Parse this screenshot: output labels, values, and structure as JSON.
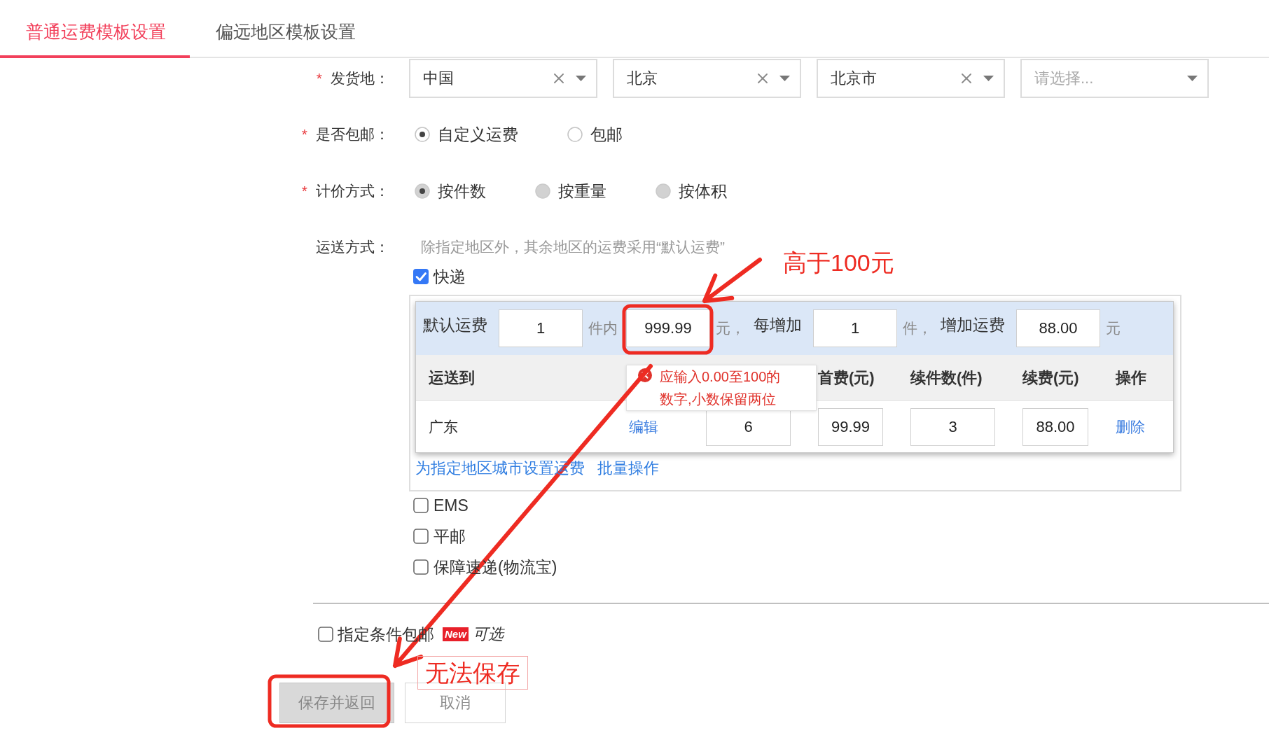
{
  "tabs": [
    {
      "label": "普通运费模板设置",
      "selected": true
    },
    {
      "label": "偏远地区模板设置",
      "selected": false
    }
  ],
  "ship_from": {
    "required_mark": "*",
    "label": "发货地：",
    "selects": [
      {
        "value": "中国"
      },
      {
        "value": "北京"
      },
      {
        "value": "北京市"
      },
      {
        "placeholder": "请选择..."
      }
    ]
  },
  "free_shipping": {
    "required_mark": "*",
    "label": "是否包邮：",
    "disabled": false,
    "options": [
      {
        "label": "自定义运费",
        "selected": true
      },
      {
        "label": "包邮",
        "selected": false
      }
    ]
  },
  "pricing_method": {
    "required_mark": "*",
    "label": "计价方式：",
    "disabled": true,
    "options": [
      {
        "label": "按件数",
        "selected": true
      },
      {
        "label": "按重量",
        "selected": false
      },
      {
        "label": "按体积",
        "selected": false
      }
    ]
  },
  "delivery": {
    "label": "运送方式：",
    "hint": "除指定地区外，其余地区的运费采用“默认运费”",
    "methods": [
      {
        "label": "快递",
        "checked": true,
        "panel": {
          "default_fee": [
            {
              "kind": "label",
              "text": "默认运费"
            },
            {
              "kind": "input",
              "value": "1"
            },
            {
              "kind": "unit",
              "text": "件内"
            },
            {
              "kind": "input",
              "value": "999.99"
            },
            {
              "kind": "unit",
              "text": "元，"
            },
            {
              "kind": "label",
              "text": "每增加"
            },
            {
              "kind": "input",
              "value": "1"
            },
            {
              "kind": "unit",
              "text": "件，"
            },
            {
              "kind": "label",
              "text": "增加运费"
            },
            {
              "kind": "input",
              "value": "88.00"
            },
            {
              "kind": "unit",
              "text": "元"
            }
          ],
          "columns": [
            {
              "kind": "heading",
              "label": "运送到"
            },
            {
              "kind": "covered"
            },
            {
              "kind": "covered"
            },
            {
              "kind": "heading",
              "label": "首费(元)"
            },
            {
              "kind": "heading",
              "label": "续件数(件)"
            },
            {
              "kind": "heading",
              "label": "续费(元)"
            },
            {
              "kind": "heading",
              "label": "操作"
            }
          ],
          "rows": [
            {
              "cells": [
                {
                  "kind": "text",
                  "text": "广东"
                },
                {
                  "kind": "link",
                  "text": "编辑"
                },
                {
                  "kind": "input",
                  "value": "6"
                },
                {
                  "kind": "input",
                  "value": "99.99"
                },
                {
                  "kind": "input",
                  "value": "3"
                },
                {
                  "kind": "input",
                  "value": "88.00"
                },
                {
                  "kind": "link",
                  "text": "删除"
                }
              ]
            }
          ],
          "error_tooltip": {
            "lines": [
              "应输入0.00至100的",
              "数字,小数保留两位"
            ]
          },
          "links": [
            "为指定地区城市设置运费",
            "批量操作"
          ]
        }
      },
      {
        "label": "EMS",
        "checked": false
      },
      {
        "label": "平邮",
        "checked": false
      },
      {
        "label": "保障速递(物流宝)",
        "checked": false
      }
    ]
  },
  "conditional_free_shipping": {
    "label": "指定条件包邮",
    "checked": false,
    "badge": "New",
    "note": "可选"
  },
  "buttons": [
    {
      "label": "保存并返回",
      "disabled": true
    },
    {
      "label": "取消",
      "disabled": false
    }
  ],
  "annotations": [
    {
      "kind": "plain",
      "text": "高于100元"
    },
    {
      "kind": "framed",
      "text": "无法保存"
    }
  ]
}
